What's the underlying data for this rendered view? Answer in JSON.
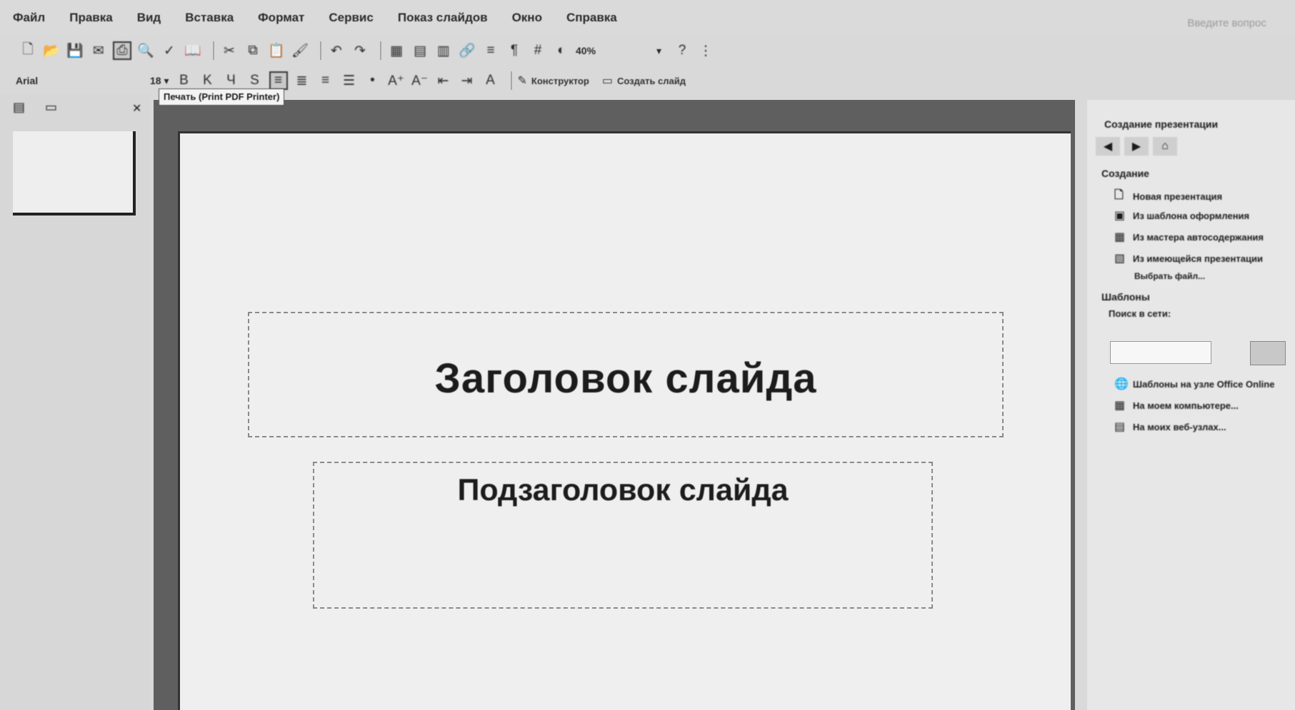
{
  "menu": {
    "items": [
      "Файл",
      "Правка",
      "Вид",
      "Вставка",
      "Формат",
      "Сервис",
      "Показ слайдов",
      "Окно",
      "Справка"
    ],
    "window_caption": "Введите вопрос"
  },
  "toolbar": {
    "zoom": "40%",
    "font_name": "Arial",
    "font_size": "18",
    "tooltip": "Печать (Print PDF Printer)",
    "design_label": "Конструктор",
    "new_slide_label": "Создать слайд"
  },
  "slide": {
    "title": "Заголовок слайда",
    "subtitle": "Подзаголовок слайда"
  },
  "task_pane": {
    "title": "Создание презентации",
    "create_heading": "Создание",
    "create_items": [
      "Новая презентация",
      "Из шаблона оформления",
      "Из мастера автосодержания",
      "Из имеющейся презентации"
    ],
    "choose_label": "Выбрать файл...",
    "templates_heading": "Шаблоны",
    "search_online_label": "Поиск в сети:",
    "template_items": [
      "Шаблоны на узле Office Online",
      "На моем компьютере...",
      "На моих веб-узлах..."
    ]
  }
}
